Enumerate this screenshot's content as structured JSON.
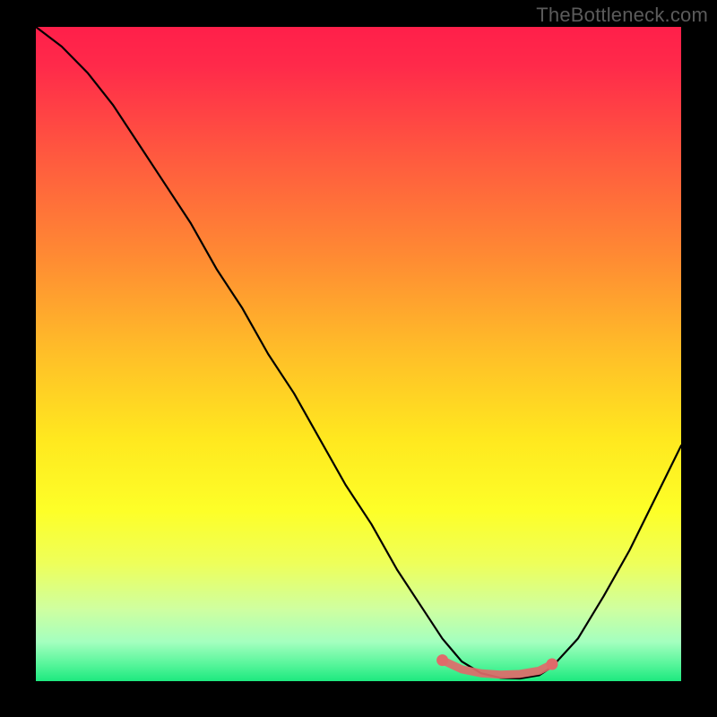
{
  "watermark": "TheBottleneck.com",
  "chart_data": {
    "type": "line",
    "title": "",
    "xlabel": "",
    "ylabel": "",
    "xlim": [
      0,
      100
    ],
    "ylim": [
      0,
      100
    ],
    "grid": false,
    "legend": false,
    "gradient_stops": [
      {
        "offset": 0.0,
        "color": "#ff1f4a"
      },
      {
        "offset": 0.06,
        "color": "#ff2a4a"
      },
      {
        "offset": 0.2,
        "color": "#ff5a3f"
      },
      {
        "offset": 0.35,
        "color": "#ff8a33"
      },
      {
        "offset": 0.5,
        "color": "#ffbf28"
      },
      {
        "offset": 0.63,
        "color": "#ffe81f"
      },
      {
        "offset": 0.74,
        "color": "#fdff28"
      },
      {
        "offset": 0.82,
        "color": "#eeff5a"
      },
      {
        "offset": 0.89,
        "color": "#cfffa0"
      },
      {
        "offset": 0.94,
        "color": "#a4ffbf"
      },
      {
        "offset": 0.975,
        "color": "#55f59a"
      },
      {
        "offset": 1.0,
        "color": "#1de97f"
      }
    ],
    "series": [
      {
        "name": "bottleneck-curve",
        "color": "#000000",
        "width": 2.2,
        "x": [
          0,
          4,
          8,
          12,
          16,
          20,
          24,
          28,
          32,
          36,
          40,
          44,
          48,
          52,
          56,
          60,
          63,
          66,
          69,
          72,
          75,
          78,
          80,
          84,
          88,
          92,
          96,
          100
        ],
        "y": [
          100,
          97,
          93,
          88,
          82,
          76,
          70,
          63,
          57,
          50,
          44,
          37,
          30,
          24,
          17,
          11,
          6.5,
          3.0,
          1.2,
          0.5,
          0.4,
          0.9,
          2.2,
          6.5,
          13,
          20,
          28,
          36
        ]
      }
    ],
    "highlight": {
      "name": "optimal-band",
      "color": "#e06a6a",
      "x": [
        63,
        66,
        69,
        72,
        75,
        78,
        80
      ],
      "y": [
        3.2,
        1.8,
        1.2,
        1.0,
        1.1,
        1.6,
        2.6
      ],
      "endpoints": [
        {
          "x": 63,
          "y": 3.2
        },
        {
          "x": 80,
          "y": 2.6
        }
      ]
    }
  }
}
